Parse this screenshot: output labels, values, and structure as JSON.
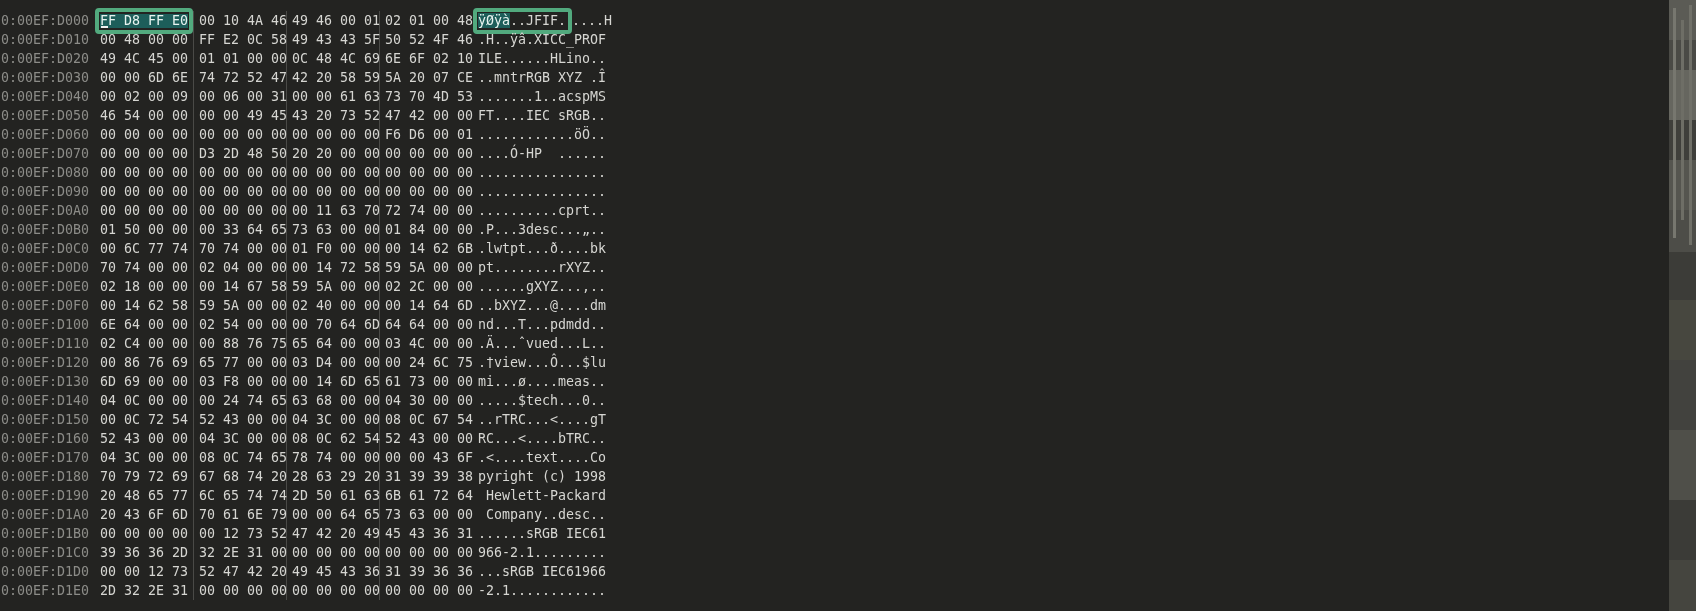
{
  "rows": [
    {
      "address": "0:00EF:D000",
      "groups": [
        {
          "text": "FF D8 FF E0",
          "selected": true,
          "framed": true,
          "cursor": true
        },
        {
          "text": "00 10 4A 46",
          "selected": false,
          "framed": false,
          "cursor": false
        },
        {
          "text": "49 46 00 01",
          "selected": false,
          "framed": false,
          "cursor": false
        },
        {
          "text": "02 01 00 48",
          "selected": false,
          "framed": false,
          "cursor": false
        }
      ],
      "ascii": [
        {
          "text": "ÿØÿà",
          "selected": true,
          "framed": true
        },
        {
          "text": "..JFIF.",
          "selected": false,
          "framed": true
        },
        {
          "text": "....H",
          "selected": false,
          "framed": false
        }
      ]
    },
    {
      "address": "0:00EF:D010",
      "groups": [
        {
          "text": "00 48 00 00",
          "selected": false,
          "framed": false,
          "cursor": false
        },
        {
          "text": "FF E2 0C 58",
          "selected": false,
          "framed": false,
          "cursor": false
        },
        {
          "text": "49 43 43 5F",
          "selected": false,
          "framed": false,
          "cursor": false
        },
        {
          "text": "50 52 4F 46",
          "selected": false,
          "framed": false,
          "cursor": false
        }
      ],
      "ascii": [
        {
          "text": ".H..ÿâ.XICC_PROF",
          "selected": false,
          "framed": false
        }
      ]
    },
    {
      "address": "0:00EF:D020",
      "groups": [
        {
          "text": "49 4C 45 00",
          "selected": false,
          "framed": false,
          "cursor": false
        },
        {
          "text": "01 01 00 00",
          "selected": false,
          "framed": false,
          "cursor": false
        },
        {
          "text": "0C 48 4C 69",
          "selected": false,
          "framed": false,
          "cursor": false
        },
        {
          "text": "6E 6F 02 10",
          "selected": false,
          "framed": false,
          "cursor": false
        }
      ],
      "ascii": [
        {
          "text": "ILE......HLino..",
          "selected": false,
          "framed": false
        }
      ]
    },
    {
      "address": "0:00EF:D030",
      "groups": [
        {
          "text": "00 00 6D 6E",
          "selected": false,
          "framed": false,
          "cursor": false
        },
        {
          "text": "74 72 52 47",
          "selected": false,
          "framed": false,
          "cursor": false
        },
        {
          "text": "42 20 58 59",
          "selected": false,
          "framed": false,
          "cursor": false
        },
        {
          "text": "5A 20 07 CE",
          "selected": false,
          "framed": false,
          "cursor": false
        }
      ],
      "ascii": [
        {
          "text": "..mntrRGB XYZ .Î",
          "selected": false,
          "framed": false
        }
      ]
    },
    {
      "address": "0:00EF:D040",
      "groups": [
        {
          "text": "00 02 00 09",
          "selected": false,
          "framed": false,
          "cursor": false
        },
        {
          "text": "00 06 00 31",
          "selected": false,
          "framed": false,
          "cursor": false
        },
        {
          "text": "00 00 61 63",
          "selected": false,
          "framed": false,
          "cursor": false
        },
        {
          "text": "73 70 4D 53",
          "selected": false,
          "framed": false,
          "cursor": false
        }
      ],
      "ascii": [
        {
          "text": ".......1..acspMS",
          "selected": false,
          "framed": false
        }
      ]
    },
    {
      "address": "0:00EF:D050",
      "groups": [
        {
          "text": "46 54 00 00",
          "selected": false,
          "framed": false,
          "cursor": false
        },
        {
          "text": "00 00 49 45",
          "selected": false,
          "framed": false,
          "cursor": false
        },
        {
          "text": "43 20 73 52",
          "selected": false,
          "framed": false,
          "cursor": false
        },
        {
          "text": "47 42 00 00",
          "selected": false,
          "framed": false,
          "cursor": false
        }
      ],
      "ascii": [
        {
          "text": "FT....IEC sRGB..",
          "selected": false,
          "framed": false
        }
      ]
    },
    {
      "address": "0:00EF:D060",
      "groups": [
        {
          "text": "00 00 00 00",
          "selected": false,
          "framed": false,
          "cursor": false
        },
        {
          "text": "00 00 00 00",
          "selected": false,
          "framed": false,
          "cursor": false
        },
        {
          "text": "00 00 00 00",
          "selected": false,
          "framed": false,
          "cursor": false
        },
        {
          "text": "F6 D6 00 01",
          "selected": false,
          "framed": false,
          "cursor": false
        }
      ],
      "ascii": [
        {
          "text": "............öÖ..",
          "selected": false,
          "framed": false
        }
      ]
    },
    {
      "address": "0:00EF:D070",
      "groups": [
        {
          "text": "00 00 00 00",
          "selected": false,
          "framed": false,
          "cursor": false
        },
        {
          "text": "D3 2D 48 50",
          "selected": false,
          "framed": false,
          "cursor": false
        },
        {
          "text": "20 20 00 00",
          "selected": false,
          "framed": false,
          "cursor": false
        },
        {
          "text": "00 00 00 00",
          "selected": false,
          "framed": false,
          "cursor": false
        }
      ],
      "ascii": [
        {
          "text": "....Ó-HP  ......",
          "selected": false,
          "framed": false
        }
      ]
    },
    {
      "address": "0:00EF:D080",
      "groups": [
        {
          "text": "00 00 00 00",
          "selected": false,
          "framed": false,
          "cursor": false
        },
        {
          "text": "00 00 00 00",
          "selected": false,
          "framed": false,
          "cursor": false
        },
        {
          "text": "00 00 00 00",
          "selected": false,
          "framed": false,
          "cursor": false
        },
        {
          "text": "00 00 00 00",
          "selected": false,
          "framed": false,
          "cursor": false
        }
      ],
      "ascii": [
        {
          "text": "................",
          "selected": false,
          "framed": false
        }
      ]
    },
    {
      "address": "0:00EF:D090",
      "groups": [
        {
          "text": "00 00 00 00",
          "selected": false,
          "framed": false,
          "cursor": false
        },
        {
          "text": "00 00 00 00",
          "selected": false,
          "framed": false,
          "cursor": false
        },
        {
          "text": "00 00 00 00",
          "selected": false,
          "framed": false,
          "cursor": false
        },
        {
          "text": "00 00 00 00",
          "selected": false,
          "framed": false,
          "cursor": false
        }
      ],
      "ascii": [
        {
          "text": "................",
          "selected": false,
          "framed": false
        }
      ]
    },
    {
      "address": "0:00EF:D0A0",
      "groups": [
        {
          "text": "00 00 00 00",
          "selected": false,
          "framed": false,
          "cursor": false
        },
        {
          "text": "00 00 00 00",
          "selected": false,
          "framed": false,
          "cursor": false
        },
        {
          "text": "00 11 63 70",
          "selected": false,
          "framed": false,
          "cursor": false
        },
        {
          "text": "72 74 00 00",
          "selected": false,
          "framed": false,
          "cursor": false
        }
      ],
      "ascii": [
        {
          "text": "..........cprt..",
          "selected": false,
          "framed": false
        }
      ]
    },
    {
      "address": "0:00EF:D0B0",
      "groups": [
        {
          "text": "01 50 00 00",
          "selected": false,
          "framed": false,
          "cursor": false
        },
        {
          "text": "00 33 64 65",
          "selected": false,
          "framed": false,
          "cursor": false
        },
        {
          "text": "73 63 00 00",
          "selected": false,
          "framed": false,
          "cursor": false
        },
        {
          "text": "01 84 00 00",
          "selected": false,
          "framed": false,
          "cursor": false
        }
      ],
      "ascii": [
        {
          "text": ".P...3desc...„..",
          "selected": false,
          "framed": false
        }
      ]
    },
    {
      "address": "0:00EF:D0C0",
      "groups": [
        {
          "text": "00 6C 77 74",
          "selected": false,
          "framed": false,
          "cursor": false
        },
        {
          "text": "70 74 00 00",
          "selected": false,
          "framed": false,
          "cursor": false
        },
        {
          "text": "01 F0 00 00",
          "selected": false,
          "framed": false,
          "cursor": false
        },
        {
          "text": "00 14 62 6B",
          "selected": false,
          "framed": false,
          "cursor": false
        }
      ],
      "ascii": [
        {
          "text": ".lwtpt...ð....bk",
          "selected": false,
          "framed": false
        }
      ]
    },
    {
      "address": "0:00EF:D0D0",
      "groups": [
        {
          "text": "70 74 00 00",
          "selected": false,
          "framed": false,
          "cursor": false
        },
        {
          "text": "02 04 00 00",
          "selected": false,
          "framed": false,
          "cursor": false
        },
        {
          "text": "00 14 72 58",
          "selected": false,
          "framed": false,
          "cursor": false
        },
        {
          "text": "59 5A 00 00",
          "selected": false,
          "framed": false,
          "cursor": false
        }
      ],
      "ascii": [
        {
          "text": "pt........rXYZ..",
          "selected": false,
          "framed": false
        }
      ]
    },
    {
      "address": "0:00EF:D0E0",
      "groups": [
        {
          "text": "02 18 00 00",
          "selected": false,
          "framed": false,
          "cursor": false
        },
        {
          "text": "00 14 67 58",
          "selected": false,
          "framed": false,
          "cursor": false
        },
        {
          "text": "59 5A 00 00",
          "selected": false,
          "framed": false,
          "cursor": false
        },
        {
          "text": "02 2C 00 00",
          "selected": false,
          "framed": false,
          "cursor": false
        }
      ],
      "ascii": [
        {
          "text": "......gXYZ...,..",
          "selected": false,
          "framed": false
        }
      ]
    },
    {
      "address": "0:00EF:D0F0",
      "groups": [
        {
          "text": "00 14 62 58",
          "selected": false,
          "framed": false,
          "cursor": false
        },
        {
          "text": "59 5A 00 00",
          "selected": false,
          "framed": false,
          "cursor": false
        },
        {
          "text": "02 40 00 00",
          "selected": false,
          "framed": false,
          "cursor": false
        },
        {
          "text": "00 14 64 6D",
          "selected": false,
          "framed": false,
          "cursor": false
        }
      ],
      "ascii": [
        {
          "text": "..bXYZ...@....dm",
          "selected": false,
          "framed": false
        }
      ]
    },
    {
      "address": "0:00EF:D100",
      "groups": [
        {
          "text": "6E 64 00 00",
          "selected": false,
          "framed": false,
          "cursor": false
        },
        {
          "text": "02 54 00 00",
          "selected": false,
          "framed": false,
          "cursor": false
        },
        {
          "text": "00 70 64 6D",
          "selected": false,
          "framed": false,
          "cursor": false
        },
        {
          "text": "64 64 00 00",
          "selected": false,
          "framed": false,
          "cursor": false
        }
      ],
      "ascii": [
        {
          "text": "nd...T...pdmdd..",
          "selected": false,
          "framed": false
        }
      ]
    },
    {
      "address": "0:00EF:D110",
      "groups": [
        {
          "text": "02 C4 00 00",
          "selected": false,
          "framed": false,
          "cursor": false
        },
        {
          "text": "00 88 76 75",
          "selected": false,
          "framed": false,
          "cursor": false
        },
        {
          "text": "65 64 00 00",
          "selected": false,
          "framed": false,
          "cursor": false
        },
        {
          "text": "03 4C 00 00",
          "selected": false,
          "framed": false,
          "cursor": false
        }
      ],
      "ascii": [
        {
          "text": ".Ä...ˆvued...L..",
          "selected": false,
          "framed": false
        }
      ]
    },
    {
      "address": "0:00EF:D120",
      "groups": [
        {
          "text": "00 86 76 69",
          "selected": false,
          "framed": false,
          "cursor": false
        },
        {
          "text": "65 77 00 00",
          "selected": false,
          "framed": false,
          "cursor": false
        },
        {
          "text": "03 D4 00 00",
          "selected": false,
          "framed": false,
          "cursor": false
        },
        {
          "text": "00 24 6C 75",
          "selected": false,
          "framed": false,
          "cursor": false
        }
      ],
      "ascii": [
        {
          "text": ".†view...Ô...$lu",
          "selected": false,
          "framed": false
        }
      ]
    },
    {
      "address": "0:00EF:D130",
      "groups": [
        {
          "text": "6D 69 00 00",
          "selected": false,
          "framed": false,
          "cursor": false
        },
        {
          "text": "03 F8 00 00",
          "selected": false,
          "framed": false,
          "cursor": false
        },
        {
          "text": "00 14 6D 65",
          "selected": false,
          "framed": false,
          "cursor": false
        },
        {
          "text": "61 73 00 00",
          "selected": false,
          "framed": false,
          "cursor": false
        }
      ],
      "ascii": [
        {
          "text": "mi...ø....meas..",
          "selected": false,
          "framed": false
        }
      ]
    },
    {
      "address": "0:00EF:D140",
      "groups": [
        {
          "text": "04 0C 00 00",
          "selected": false,
          "framed": false,
          "cursor": false
        },
        {
          "text": "00 24 74 65",
          "selected": false,
          "framed": false,
          "cursor": false
        },
        {
          "text": "63 68 00 00",
          "selected": false,
          "framed": false,
          "cursor": false
        },
        {
          "text": "04 30 00 00",
          "selected": false,
          "framed": false,
          "cursor": false
        }
      ],
      "ascii": [
        {
          "text": ".....$tech...0..",
          "selected": false,
          "framed": false
        }
      ]
    },
    {
      "address": "0:00EF:D150",
      "groups": [
        {
          "text": "00 0C 72 54",
          "selected": false,
          "framed": false,
          "cursor": false
        },
        {
          "text": "52 43 00 00",
          "selected": false,
          "framed": false,
          "cursor": false
        },
        {
          "text": "04 3C 00 00",
          "selected": false,
          "framed": false,
          "cursor": false
        },
        {
          "text": "08 0C 67 54",
          "selected": false,
          "framed": false,
          "cursor": false
        }
      ],
      "ascii": [
        {
          "text": "..rTRC...<....gT",
          "selected": false,
          "framed": false
        }
      ]
    },
    {
      "address": "0:00EF:D160",
      "groups": [
        {
          "text": "52 43 00 00",
          "selected": false,
          "framed": false,
          "cursor": false
        },
        {
          "text": "04 3C 00 00",
          "selected": false,
          "framed": false,
          "cursor": false
        },
        {
          "text": "08 0C 62 54",
          "selected": false,
          "framed": false,
          "cursor": false
        },
        {
          "text": "52 43 00 00",
          "selected": false,
          "framed": false,
          "cursor": false
        }
      ],
      "ascii": [
        {
          "text": "RC...<....bTRC..",
          "selected": false,
          "framed": false
        }
      ]
    },
    {
      "address": "0:00EF:D170",
      "groups": [
        {
          "text": "04 3C 00 00",
          "selected": false,
          "framed": false,
          "cursor": false
        },
        {
          "text": "08 0C 74 65",
          "selected": false,
          "framed": false,
          "cursor": false
        },
        {
          "text": "78 74 00 00",
          "selected": false,
          "framed": false,
          "cursor": false
        },
        {
          "text": "00 00 43 6F",
          "selected": false,
          "framed": false,
          "cursor": false
        }
      ],
      "ascii": [
        {
          "text": ".<....text....Co",
          "selected": false,
          "framed": false
        }
      ]
    },
    {
      "address": "0:00EF:D180",
      "groups": [
        {
          "text": "70 79 72 69",
          "selected": false,
          "framed": false,
          "cursor": false
        },
        {
          "text": "67 68 74 20",
          "selected": false,
          "framed": false,
          "cursor": false
        },
        {
          "text": "28 63 29 20",
          "selected": false,
          "framed": false,
          "cursor": false
        },
        {
          "text": "31 39 39 38",
          "selected": false,
          "framed": false,
          "cursor": false
        }
      ],
      "ascii": [
        {
          "text": "pyright (c) 1998",
          "selected": false,
          "framed": false
        }
      ]
    },
    {
      "address": "0:00EF:D190",
      "groups": [
        {
          "text": "20 48 65 77",
          "selected": false,
          "framed": false,
          "cursor": false
        },
        {
          "text": "6C 65 74 74",
          "selected": false,
          "framed": false,
          "cursor": false
        },
        {
          "text": "2D 50 61 63",
          "selected": false,
          "framed": false,
          "cursor": false
        },
        {
          "text": "6B 61 72 64",
          "selected": false,
          "framed": false,
          "cursor": false
        }
      ],
      "ascii": [
        {
          "text": " Hewlett-Packard",
          "selected": false,
          "framed": false
        }
      ]
    },
    {
      "address": "0:00EF:D1A0",
      "groups": [
        {
          "text": "20 43 6F 6D",
          "selected": false,
          "framed": false,
          "cursor": false
        },
        {
          "text": "70 61 6E 79",
          "selected": false,
          "framed": false,
          "cursor": false
        },
        {
          "text": "00 00 64 65",
          "selected": false,
          "framed": false,
          "cursor": false
        },
        {
          "text": "73 63 00 00",
          "selected": false,
          "framed": false,
          "cursor": false
        }
      ],
      "ascii": [
        {
          "text": " Company..desc..",
          "selected": false,
          "framed": false
        }
      ]
    },
    {
      "address": "0:00EF:D1B0",
      "groups": [
        {
          "text": "00 00 00 00",
          "selected": false,
          "framed": false,
          "cursor": false
        },
        {
          "text": "00 12 73 52",
          "selected": false,
          "framed": false,
          "cursor": false
        },
        {
          "text": "47 42 20 49",
          "selected": false,
          "framed": false,
          "cursor": false
        },
        {
          "text": "45 43 36 31",
          "selected": false,
          "framed": false,
          "cursor": false
        }
      ],
      "ascii": [
        {
          "text": "......sRGB IEC61",
          "selected": false,
          "framed": false
        }
      ]
    },
    {
      "address": "0:00EF:D1C0",
      "groups": [
        {
          "text": "39 36 36 2D",
          "selected": false,
          "framed": false,
          "cursor": false
        },
        {
          "text": "32 2E 31 00",
          "selected": false,
          "framed": false,
          "cursor": false
        },
        {
          "text": "00 00 00 00",
          "selected": false,
          "framed": false,
          "cursor": false
        },
        {
          "text": "00 00 00 00",
          "selected": false,
          "framed": false,
          "cursor": false
        }
      ],
      "ascii": [
        {
          "text": "966-2.1.........",
          "selected": false,
          "framed": false
        }
      ]
    },
    {
      "address": "0:00EF:D1D0",
      "groups": [
        {
          "text": "00 00 12 73",
          "selected": false,
          "framed": false,
          "cursor": false
        },
        {
          "text": "52 47 42 20",
          "selected": false,
          "framed": false,
          "cursor": false
        },
        {
          "text": "49 45 43 36",
          "selected": false,
          "framed": false,
          "cursor": false
        },
        {
          "text": "31 39 36 36",
          "selected": false,
          "framed": false,
          "cursor": false
        }
      ],
      "ascii": [
        {
          "text": "...sRGB IEC61966",
          "selected": false,
          "framed": false
        }
      ]
    },
    {
      "address": "0:00EF:D1E0",
      "groups": [
        {
          "text": "2D 32 2E 31",
          "selected": false,
          "framed": false,
          "cursor": false
        },
        {
          "text": "00 00 00 00",
          "selected": false,
          "framed": false,
          "cursor": false
        },
        {
          "text": "00 00 00 00",
          "selected": false,
          "framed": false,
          "cursor": false
        },
        {
          "text": "00 00 00 00",
          "selected": false,
          "framed": false,
          "cursor": false
        }
      ],
      "ascii": [
        {
          "text": "-2.1............",
          "selected": false,
          "framed": false
        }
      ]
    }
  ]
}
